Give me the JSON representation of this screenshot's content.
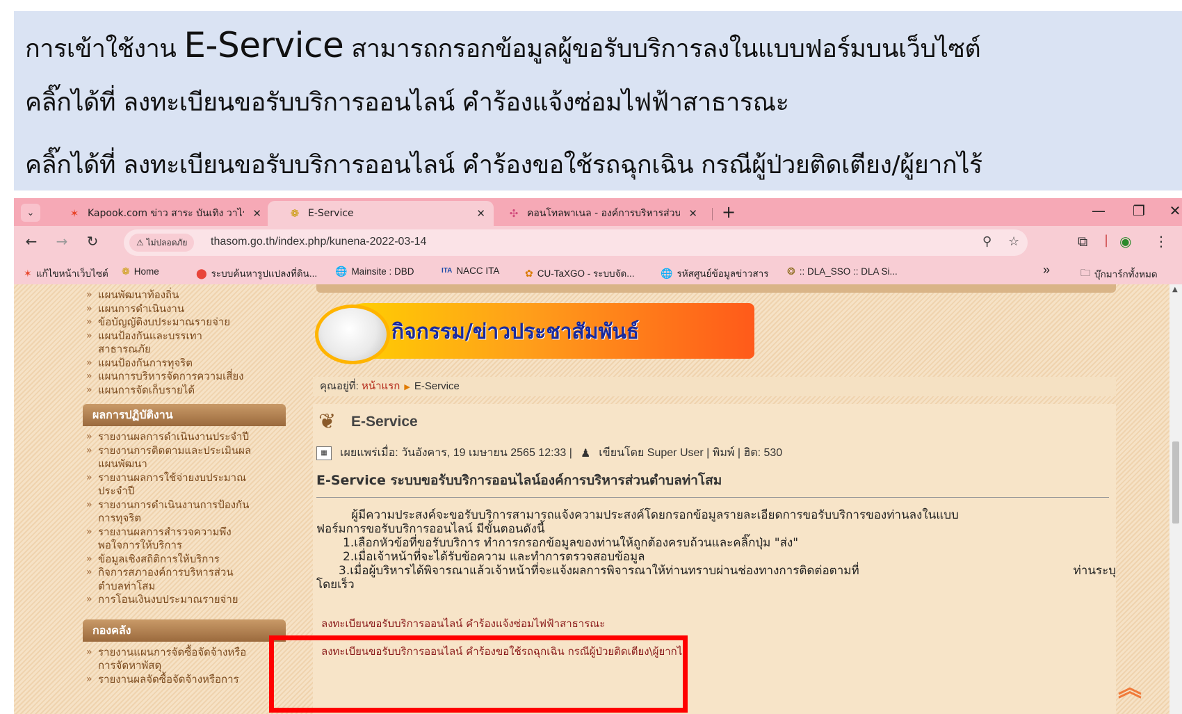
{
  "slide": {
    "line1_prefix": "การเข้าใช้งาน ",
    "line1_brand": "E-Service",
    "line1_suffix": " สามารถกรอกข้อมูลผู้ขอรับบริการลงในแบบฟอร์มบนเว็บไซต์",
    "line2": "คลิ๊กได้ที่ ลงทะเบียนขอรับบริการออนไลน์ คำร้องแจ้งซ่อมไฟฟ้าสาธารณะ",
    "line3": "คลิ๊กได้ที่ ลงทะเบียนขอรับบริการออนไลน์ คำร้องขอใช้รถฉุกเฉิน กรณีผู้ป่วยติดเตียง/ผู้ยากไร้"
  },
  "browser": {
    "tabs": [
      {
        "title": "Kapook.com ข่าว สาระ บันเทิง วาไร",
        "active": false
      },
      {
        "title": "E-Service",
        "active": true
      },
      {
        "title": "คอนโทลพาเนล - องค์การบริหารส่วนต",
        "active": false
      }
    ],
    "security_label": "ไม่ปลอดภัย",
    "url": "thasom.go.th/index.php/kunena-2022-03-14",
    "bookmarks": [
      "แก้ไขหน้าเว็บไซต์",
      "Home",
      "ระบบค้นหารูปแปลงที่ดิน...",
      "Mainsite : DBD",
      "NACC ITA",
      "CU-TaXGO - ระบบจัด...",
      "รหัสศูนย์ข้อมูลข่าวสาร",
      ":: DLA_SSO :: DLA Si..."
    ],
    "bookmarks_more": "»",
    "all_bookmarks": "บุ๊กมาร์กทั้งหมด"
  },
  "sidebar": {
    "plans": [
      "แผนพัฒนาท้องถิ่น",
      "แผนการดำเนินงาน",
      "ข้อบัญญัติงบประมาณรายจ่าย",
      "แผนป้องกันและบรรเทา",
      "สาธารณภัย",
      "แผนป้องกันการทุจริต",
      "แผนการบริหารจัดการความเสี่ยง",
      "แผนการจัดเก็บรายได้"
    ],
    "performance_heading": "ผลการปฏิบัติงาน",
    "performance": [
      "รายงานผลการดำเนินงานประจำปี",
      "รายงานการติดตามและประเมินผล",
      "แผนพัฒนา",
      "รายงานผลการใช้จ่ายงบประมาณ",
      "ประจำปี",
      "รายงานการดำเนินงานการป้องกัน",
      "การทุจริต",
      "รายงานผลการสำรวจความพึง",
      "พอใจการให้บริการ",
      "ข้อมูลเชิงสถิติการให้บริการ",
      "กิจการสภาองค์การบริหารส่วน",
      "ตำบลท่าโสม",
      "การโอนเงินงบประมาณรายจ่าย"
    ],
    "treasury_heading": "กองคลัง",
    "treasury": [
      "รายงานแผนการจัดซื้อจัดจ้างหรือ",
      "การจัดหาพัสดุ",
      "รายงานผลจัดซื้อจัดจ้างหรือการ"
    ]
  },
  "content": {
    "banner_title": "กิจกรรม/ข่าวประชาสัมพันธ์",
    "breadcrumb": {
      "prefix": "คุณอยู่ที่: ",
      "home": "หน้าแรก",
      "current": "E-Service"
    },
    "article_title": "E-Service",
    "meta": {
      "published": "เผยแพร่เมื่อ: วันอังคาร, 19 เมษายน 2565 12:33 |",
      "author": "เขียนโดย Super User | พิมพ์ | ฮิต: 530"
    },
    "subheading": "E-Service ระบบขอรับบริการออนไลน์องค์การบริหารส่วนตำบลท่าโสม",
    "intro": "ผู้มีความประสงค์จะขอรับบริการสามารถแจ้งความประสงค์โดยกรอกข้อมูลรายละเอียดการขอรับบริการของท่านลงในแบบ",
    "intro2": "ฟอร์มการขอรับบริการออนไลน์ มีขั้นตอนดังนี้",
    "step1": "1.เลือกหัวข้อที่ขอรับบริการ ทำการกรอกข้อมูลของท่านให้ถูกต้องครบถ้วนและคลิ๊กปุ่ม \"ส่ง\"",
    "step2": "2.เมื่อเจ้าหน้าที่จะได้รับข้อความ และทำการตรวจสอบข้อมูล",
    "step3a": "3.เมื่อผู้บริหารได้พิจารณาแล้วเจ้าหน้าที่จะแจ้งผลการพิจารณาให้ท่านทราบผ่านช่องทางการติดต่อตามที่",
    "step3b": "ท่านระบุ",
    "step3c": "โดยเร็ว",
    "link_repair": "ลงทะเบียนขอรับบริการออนไลน์ คำร้องแจ้งซ่อมไฟฟ้าสาธารณะ",
    "link_ambulance": "ลงทะเบียนขอรับบริการออนไลน์ คำร้องขอใช้รถฉุกเฉิน กรณีผู้ป่วยติดเตียง\\ผู้ยากไร้"
  },
  "colors": {
    "highlight": "#ff0000",
    "tab_strip": "#f6a9b6",
    "banner_text": "#1a2a9c"
  }
}
